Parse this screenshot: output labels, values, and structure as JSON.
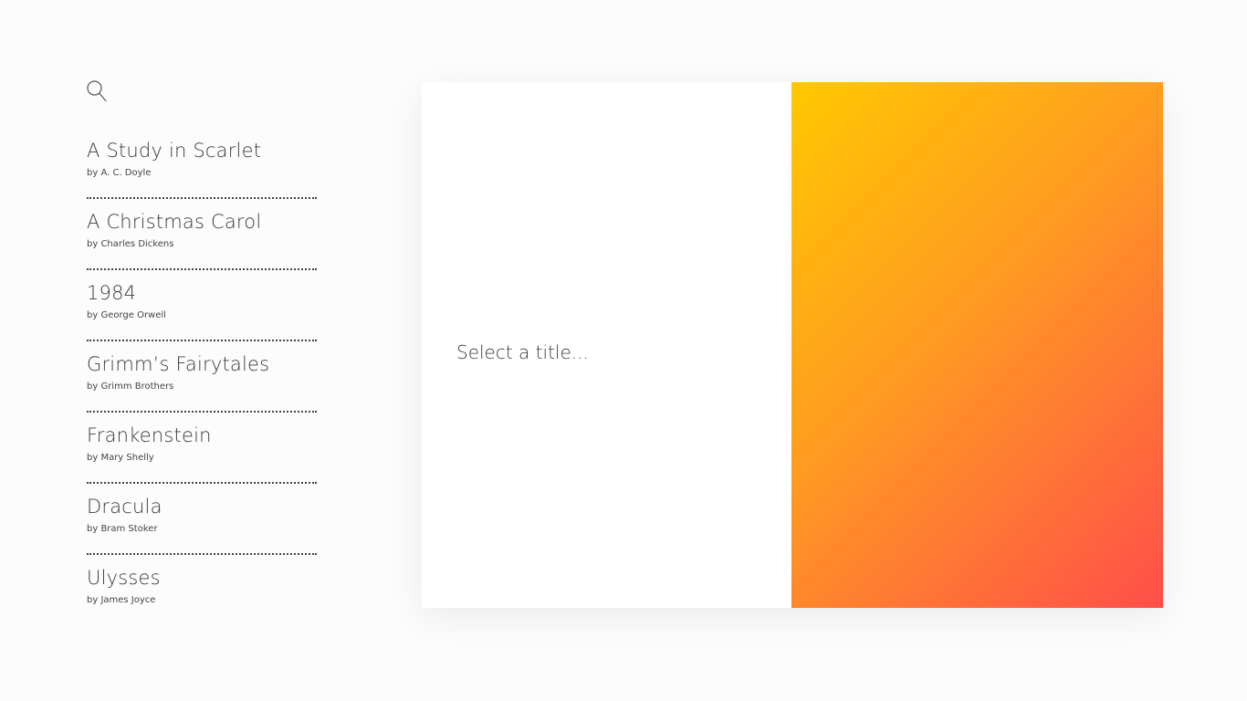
{
  "search": {
    "icon": "search-icon"
  },
  "books": [
    {
      "title": "A Study in Scarlet",
      "author": "by A. C. Doyle"
    },
    {
      "title": "A Christmas Carol",
      "author": "by Charles Dickens"
    },
    {
      "title": "1984",
      "author": "by George Orwell"
    },
    {
      "title": "Grimm’s Fairytales",
      "author": "by Grimm Brothers"
    },
    {
      "title": "Frankenstein",
      "author": "by Mary Shelly"
    },
    {
      "title": "Dracula",
      "author": "by Bram Stoker"
    },
    {
      "title": "Ulysses",
      "author": "by James Joyce"
    }
  ],
  "detail": {
    "prompt": "Select a title..."
  },
  "colors": {
    "cover_gradient_start": "#ffc800",
    "cover_gradient_end": "#ff4e4a"
  }
}
